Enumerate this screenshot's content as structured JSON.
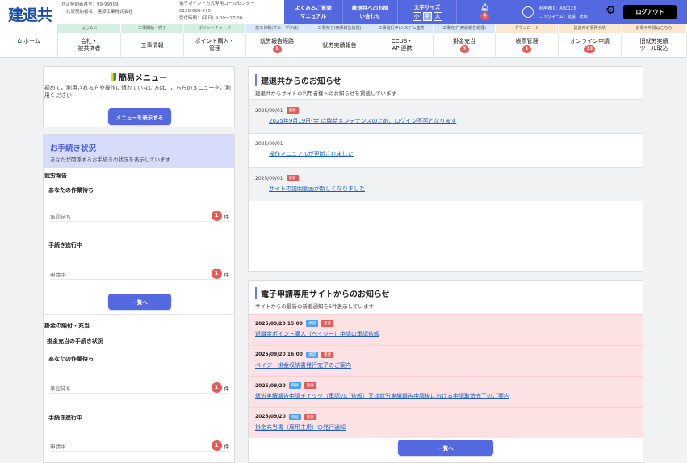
{
  "header": {
    "logo": "建退共",
    "member_no": "共済契約者番号：99-99999",
    "member_name": "共済契約者名：建設工業株式会社",
    "callcenter": "電子ポイント方式専用コールセンター",
    "phone": "0120-000-275",
    "hours": "受付時間：(平日) 9:00～17:00",
    "faq": [
      "よくあるご質問",
      "マニュアル"
    ],
    "contact": [
      "建退共へのお問",
      "い合わせ"
    ],
    "font_size_label": "文字サイズ",
    "font_sizes": [
      "小",
      "中",
      "大"
    ],
    "font_size_selected": "中",
    "bell_count": "4",
    "user_id": "利用者ID：ABC123",
    "nickname": "ニックネーム：建設　太郎",
    "logout": "ログアウト",
    "colors": {
      "accent": "#5468e0",
      "badge": "#e85a5a"
    }
  },
  "nav": {
    "home": "ホーム",
    "bands": [
      "はじめに",
      "工事開始・完了",
      "ポイントチャージ",
      "施工体制(グループ作成)",
      "工事完了(実績報告処理)",
      "工事進行中(システム連携)",
      "工事完了(実績報告処理)",
      "ダウンロード",
      "建退共の事務手続",
      "旧電子申請はこちら"
    ],
    "items": [
      {
        "l1": "会社・",
        "l2": "被共済者"
      },
      {
        "l1": "工事情報",
        "l2": ""
      },
      {
        "l1": "ポイント購入・",
        "l2": "管理"
      },
      {
        "l1": "就労報告経路",
        "badge": "1"
      },
      {
        "l1": "就労実績報告",
        "l2": ""
      },
      {
        "l1": "CCUS・",
        "l2": "API連携"
      },
      {
        "l1": "掛金充当",
        "badge": "3"
      },
      {
        "l1": "帳票管理",
        "badge": "1"
      },
      {
        "l1": "オンライン申請",
        "badge": "11"
      },
      {
        "l1": "旧就労実績",
        "l2": "ツール取込"
      }
    ]
  },
  "easy_menu": {
    "title": "簡易メニュー",
    "desc": "初めてご利用される方や操作に慣れていない方は、こちらのメニューをご利用ください",
    "button": "メニューを表示する"
  },
  "status": {
    "title": "お手続き状況",
    "desc": "あなたが関係するお手続きの状況を表示しています",
    "sec1": {
      "title": "就労報告",
      "wait": "あなたの作業待ち",
      "wait_item": "承認待ち",
      "wait_count": "1",
      "prog": "手続き進行中",
      "prog_item": "申請中",
      "prog_count": "1",
      "unit": "件",
      "button": "一覧へ"
    },
    "sec2": {
      "title": "掛金の納付・充当",
      "subtitle": "掛金充当の手続き状況",
      "wait": "あなたの作業待ち",
      "wait_item": "承認待ち",
      "wait_count": "1",
      "prog": "手続き進行中",
      "prog_item": "申請中",
      "prog_count": "1",
      "unit": "件"
    }
  },
  "notices": {
    "title": "建退共からのお知らせ",
    "desc": "建退共からサイトの利用者様へのお知らせを掲載しています",
    "items": [
      {
        "date": "2025/09/01",
        "tag": "重要",
        "text": "2025年9月19日(金)は臨時メンテナンスのため、ログイン不可となります"
      },
      {
        "date": "2025/09/01",
        "tag": "",
        "text": "操作マニュアルが更新されました"
      },
      {
        "date": "2025/09/01",
        "tag": "更新",
        "text": "サイトの説明動画が新しくなりました"
      }
    ]
  },
  "esite": {
    "title": "電子申請専用サイトからのお知らせ",
    "desc": "サイトからの最新の新着通知を5件表示しています",
    "items": [
      {
        "date": "2025/09/20 15:00",
        "tag1": "承認",
        "tag2": "重要",
        "text": "退職金ポイント購入（ペイジー）申請の承認依頼"
      },
      {
        "date": "2025/09/20 16:00",
        "tag1": "承認",
        "tag2": "重要",
        "text": "ペイジー掛金収納書発行完了のご案内"
      },
      {
        "date": "2025/09/20",
        "tag1": "申請",
        "tag2": "重要",
        "text": "就労実績報告申請チェック（承認のご依頼）又は就労実績報告申請後における申請取消完了のご案内"
      },
      {
        "date": "2025/09/20",
        "tag1": "承認",
        "tag2": "重要",
        "text": "掛金充当書（雇用主用）の発行通知"
      }
    ],
    "button": "一覧へ"
  }
}
